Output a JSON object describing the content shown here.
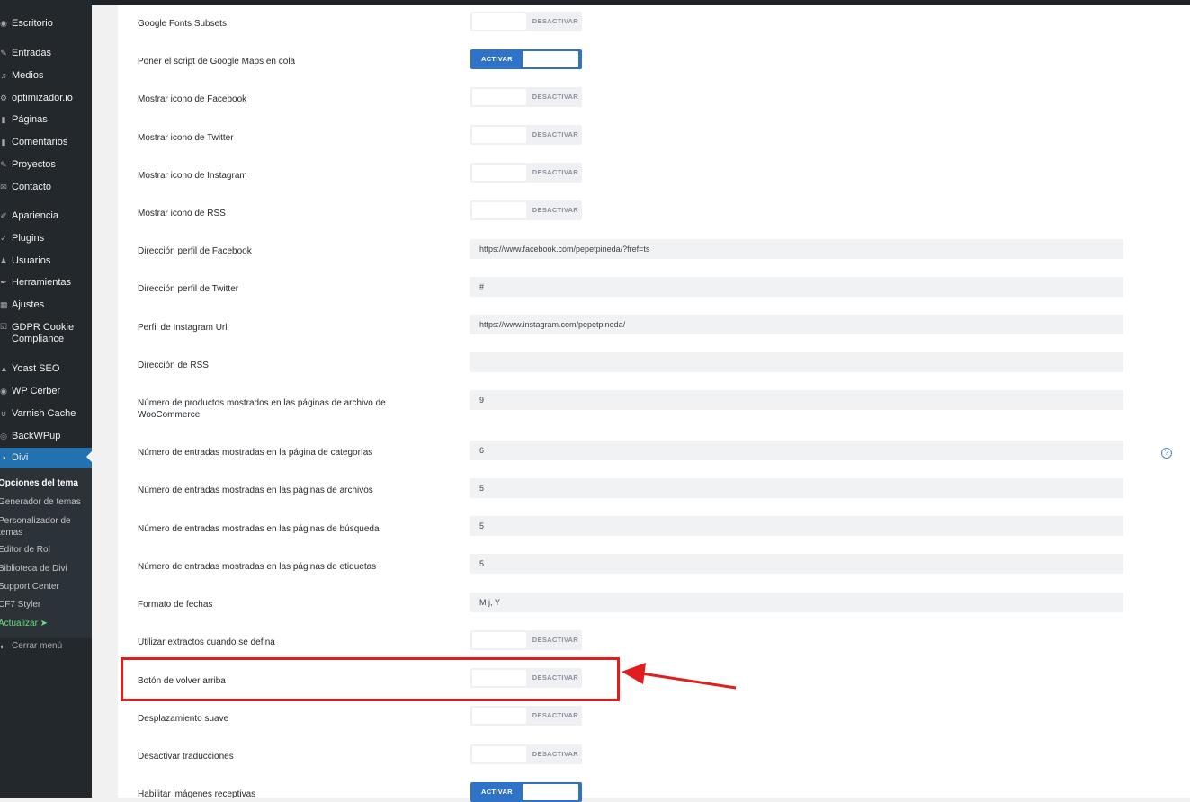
{
  "sidebar": {
    "items": [
      {
        "label": "Escritorio",
        "icon": "dashboard-icon"
      },
      {
        "label": "Entradas",
        "icon": "pin-icon"
      },
      {
        "label": "Medios",
        "icon": "media-icon"
      },
      {
        "label": "optimizador.io",
        "icon": "gear-icon"
      },
      {
        "label": "Páginas",
        "icon": "page-icon"
      },
      {
        "label": "Comentarios",
        "icon": "comment-icon"
      },
      {
        "label": "Proyectos",
        "icon": "pin-icon"
      },
      {
        "label": "Contacto",
        "icon": "mail-icon"
      },
      {
        "label": "Apariencia",
        "icon": "brush-icon"
      },
      {
        "label": "Plugins",
        "icon": "plug-icon"
      },
      {
        "label": "Usuarios",
        "icon": "user-icon"
      },
      {
        "label": "Herramientas",
        "icon": "wrench-icon"
      },
      {
        "label": "Ajustes",
        "icon": "settings-icon"
      },
      {
        "label": "GDPR Cookie Compliance",
        "icon": "check-icon"
      },
      {
        "label": "Yoast SEO",
        "icon": "yoast-icon"
      },
      {
        "label": "WP Cerber",
        "icon": "shield-icon"
      },
      {
        "label": "Varnish Cache",
        "icon": "cache-icon"
      },
      {
        "label": "BackWPup",
        "icon": "backup-icon"
      },
      {
        "label": "Divi",
        "icon": "divi-icon"
      }
    ],
    "submenu": [
      "Opciones del tema",
      "Generador de temas",
      "Personalizador de temas",
      "Editor de Rol",
      "Biblioteca de Divi",
      "Support Center",
      "CF7 Styler",
      "Actualizar ➤"
    ],
    "collapse_label": "Cerrar menú"
  },
  "settings": [
    {
      "label": "Google Fonts Subsets",
      "type": "toggle",
      "state": "DESACTIVAR"
    },
    {
      "label": "Poner el script de Google Maps en cola",
      "type": "toggle",
      "state": "ACTIVAR"
    },
    {
      "label": "Mostrar icono de Facebook",
      "type": "toggle",
      "state": "DESACTIVAR"
    },
    {
      "label": "Mostrar icono de Twitter",
      "type": "toggle",
      "state": "DESACTIVAR"
    },
    {
      "label": "Mostrar icono de Instagram",
      "type": "toggle",
      "state": "DESACTIVAR"
    },
    {
      "label": "Mostrar icono de RSS",
      "type": "toggle",
      "state": "DESACTIVAR"
    },
    {
      "label": "Dirección perfil de Facebook",
      "type": "text",
      "value": "https://www.facebook.com/pepetpineda/?fref=ts"
    },
    {
      "label": "Dirección perfil de Twitter",
      "type": "text",
      "value": "#"
    },
    {
      "label": "Perfil de Instagram Url",
      "type": "text",
      "value": "https://www.instagram.com/pepetpineda/"
    },
    {
      "label": "Dirección de RSS",
      "type": "text",
      "value": ""
    },
    {
      "label": "Número de productos mostrados en las páginas de archivo de WooCommerce",
      "type": "text",
      "value": "9"
    },
    {
      "label": "Número de entradas mostradas en la página de categorías",
      "type": "text",
      "value": "6"
    },
    {
      "label": "Número de entradas mostradas en las páginas de archivos",
      "type": "text",
      "value": "5"
    },
    {
      "label": "Número de entradas mostradas en las páginas de búsqueda",
      "type": "text",
      "value": "5"
    },
    {
      "label": "Número de entradas mostradas en las páginas de etiquetas",
      "type": "text",
      "value": "5"
    },
    {
      "label": "Formato de fechas",
      "type": "text",
      "value": "M j, Y"
    },
    {
      "label": "Utilizar extractos cuando se defina",
      "type": "toggle",
      "state": "DESACTIVAR"
    },
    {
      "label": "Botón de volver arriba",
      "type": "toggle",
      "state": "DESACTIVAR"
    },
    {
      "label": "Desplazamiento suave",
      "type": "toggle",
      "state": "DESACTIVAR"
    },
    {
      "label": "Desactivar traducciones",
      "type": "toggle",
      "state": "DESACTIVAR"
    },
    {
      "label": "Habilitar imágenes receptivas",
      "type": "toggle",
      "state": "ACTIVAR"
    }
  ],
  "help_icon": "question-circle-icon",
  "colors": {
    "sidebar": "#23282d",
    "active": "#2271b1",
    "toggle_on": "#2e73c7",
    "annotation": "#e21d1d"
  }
}
